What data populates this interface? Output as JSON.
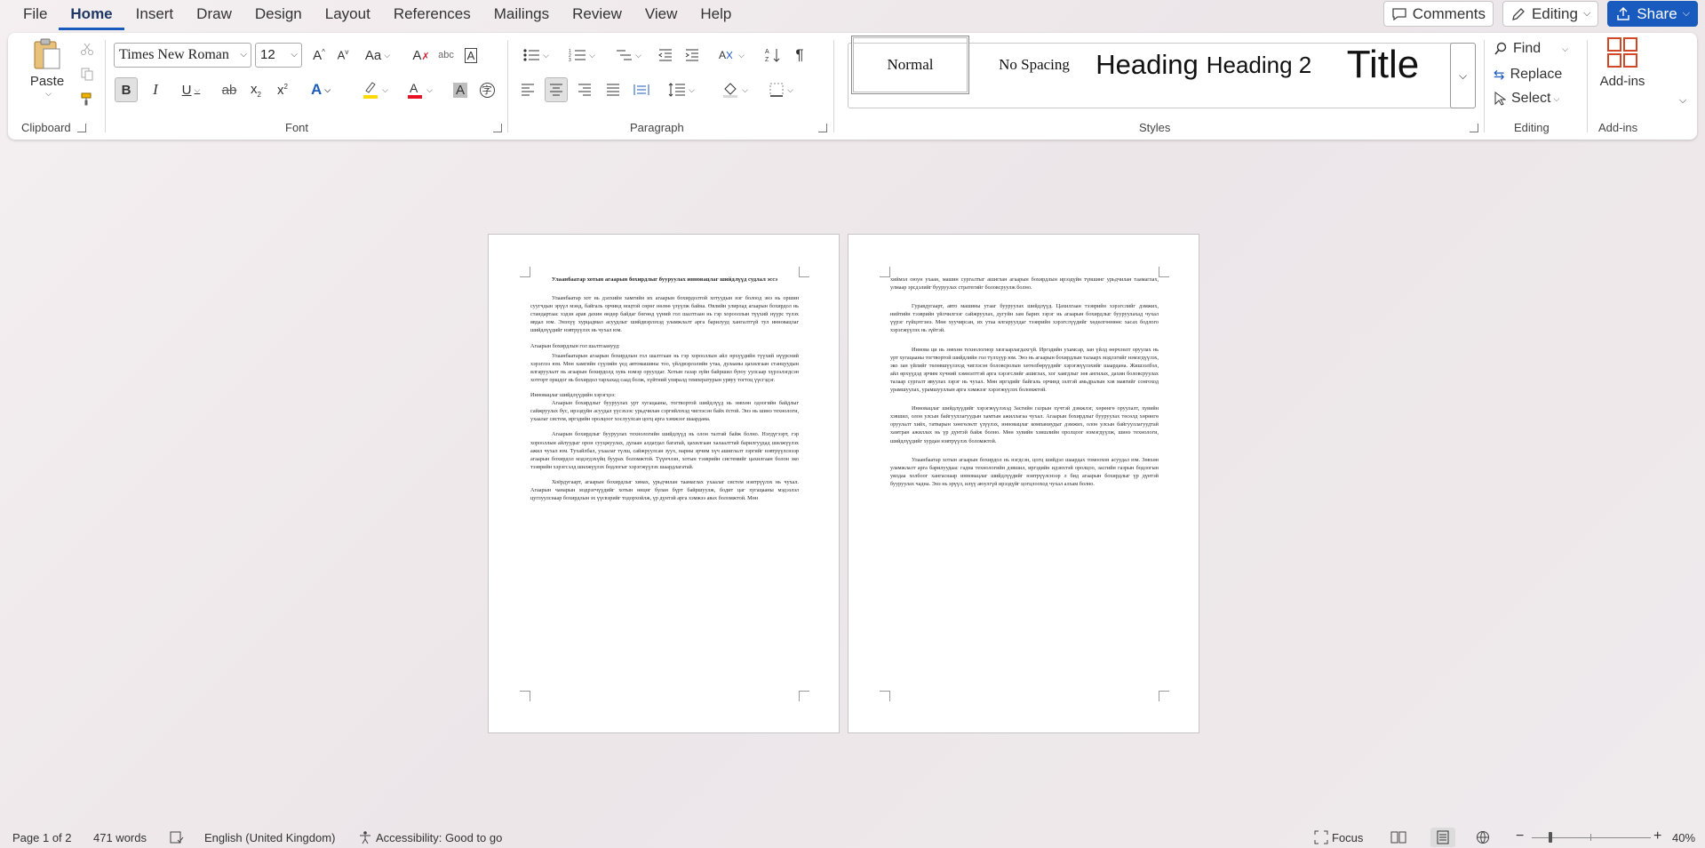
{
  "menu": {
    "tabs": [
      "File",
      "Home",
      "Insert",
      "Draw",
      "Design",
      "Layout",
      "References",
      "Mailings",
      "Review",
      "View",
      "Help"
    ],
    "active": "Home",
    "comments": "Comments",
    "editing": "Editing",
    "share": "Share"
  },
  "ribbon": {
    "clipboard": {
      "paste": "Paste",
      "label": "Clipboard"
    },
    "font": {
      "name": "Times New Roman",
      "size": "12",
      "label": "Font",
      "case_label": "Aa",
      "underline_color": "#ffd800",
      "font_color": "#e81123"
    },
    "paragraph": {
      "label": "Paragraph"
    },
    "styles": {
      "label": "Styles",
      "items": [
        "Normal",
        "No Spacing",
        "Heading",
        "Heading 2",
        "Title"
      ],
      "selected": "Normal"
    },
    "editing": {
      "find": "Find",
      "replace": "Replace",
      "select": "Select",
      "label": "Editing"
    },
    "addins": {
      "button": "Add-ins",
      "label": "Add-ins"
    }
  },
  "document": {
    "page1": {
      "title": "Улаанбаатар хотын агаарын бохирдлыг бууруулах инновацлаг шийдлүүд судлал эссэ",
      "p1": "Улаанбаатар хот нь дэлхийн хамгийн их агаарын бохирдолтой хотуудын нэг болоод энэ нь оршин суугчдын эрүүл мэнд, байгаль орчинд ноцтой сөрөг нөлөө үзүүлж байна. Өвлийн улирлад агаарын бохирдол нь стандартаас хэдэн арав дахин өндөр байдаг бөгөөд үүний гол шалтгаан нь гэр хорооллын түүхий нүүрс түлэх явдал юм. Энэхүү хурцадмал асуудлыг шийдвэрлэхэд уламжлалт арга барилууд хангалтгүй тул инновацлаг шийдлүүдийг нэвтрүүлэх нь чухал юм.",
      "h1": "Агаарын бохирдлын гол шалтгаанууд:",
      "p2": "Улаанбаатарын агаарын бохирдлын гол шалтгаан нь гэр хорооллын айл өрхүүдийн түүхий нүүрсний хэрэглээ юм. Мөн хамгийн сүүлийн үед автомашины тоо, үйлдвэрлэлийн утаа, дулааны цахилгаан станцуудын ялгаруулалт нь агаарын бохирдолд хувь нэмэр оруулдаг. Хотын газар зүйн байршил буюу уулсаар хүрээлэгдсэн хотгорт оршдог нь бохирдол тархахад саад болж, хүйтний улиралд температурын урвуу тогтоц үүсгэдэг.",
      "h2": "Инновацлаг шийдлүүдийн хэрэгцээ:",
      "p3": "Агаарын бохирдлыг бууруулах урт хугацааны, тогтвортой шийдлүүд нь зөвхөн одоогийн байдлыг сайжруулах бус, ирээдүйн асуудал үүсэхээс урьдчилан сэргийлэхэд чиглэсэн байх ёстой. Энэ нь шинэ технологи, ухаалаг систем, иргэдийн оролцоог хослуулсан цогц арга хэмжээг шаардана.",
      "p4": "Агаарын бохирдлыг бууруулах технологийн шийдлүүд нь олон талтай байж болно. Нэгдүгээрт, гэр хорооллын айлуудыг орон сууцжуулах, дулаан алдагдал багатай, цахилгаан халаалттай барилгуудад шилжүүлэх ажил чухал юм. Тухайлбал, ухаалаг түлш, сайжруулсан зуух, нарны эрчим хүч ашиглалт зэргийг нэвтрүүлснээр агаарын бохирдол мэдэгдэхүйц буурах боломжтой. Түүнчлэн, хотын тээврийн системийг цахилгаан болон эко тээврийн хэрэгсэлд шилжүүлэх бодлогыг хэрэгжүүлэх шаардлагатай.",
      "p5": "Хоёрдугаарт, агаарын бохирдлыг хянах, урьдчилан таамаглах ухаалаг систем нэвтрүүлэх нь чухал. Агаарын чанарын мэдрэгчүүдийг хотын өнцөг булан бүрт байршуулж, бодит цаг хугацааны мэдээлэл цуглуулснаар бохирдлын эх үүсвэрийг тодорхойлж, үр дүнтэй арга хэмжээ авах боломжтой. Мөн"
    },
    "page2": {
      "p1": "хиймэл оюун ухаан, машин сургалтыг ашиглан агаарын бохирдлын ирээдүйн түвшинг урьдчилан таамаглах, улмаар эрсдэлийг бууруулах стратегийг боловсруулж болно.",
      "p2": "Гуравдугаарт, авто машины утааг бууруулах шийдлүүд. Цахилгаан тээврийн хэрэгслийг дэмжих, нийтийн тээврийн үйлчилгээг сайжруулах, дугуйн зам барих зэрэг нь агаарын бохирдлыг бууруулахад чухал үүрэг гүйцэтгэнэ. Мөн хуучирсан, их утаа ялгаруулдаг тээврийн хэрэгслүүдийг хөдөлгөөнөөс хасах бодлого хэрэгжүүлэх нь зүйтэй.",
      "p3": "Иннова ци нь зөвхөн технологиор хязгаарлагдахгүй. Иргэдийн ухамсар, зан үйлд өөрчлөлт оруулах нь урт хугацааны тогтвортой шийдлийн гол түлхүүр юм. Энэ нь агаарын бохирдлын талаарх мэдлэгийг нэмэгдүүлэх, эко зан үйлийг төлөвшүүлэхэд чиглэсэн боловсролын хөтөлбөрүүдийг хэрэгжүүлэхийг шаардана. Жишээлбэл, айл өрхүүдэд эрчим хүчний хэмнэлттэй арга хэрэгслийг ашиглах, хог хаягдлыг зөв ангилах, дахин боловсруулах талаар сургалт явуулах зэрэг нь чухал. Мөн иргэдийг байгаль орчинд ээлтэй амьдралын хэв маягийг сонгоход урамшуулах, урамшууллын арга хэмжээг хэрэгжүүлэх боломжтой.",
      "p4": "Инновацлаг шийдлүүдийг хэрэгжүүлэхэд Засгийн газрын хүчтэй дэмжлэг, хөрөнгө оруулалт, хувийн хэвшил, олон улсын байгууллагуудын хамтын ажиллагаа чухал. Агаарын бохирдлыг бууруулах төсөлд хөрөнгө оруулалт хийх, татварын хөнгөлөлт үзүүлэх, инновацлаг компаниудыг дэмжих, олон улсын байгууллагуудтай хамтран ажиллах нь үр дүнтэй байж болно. Мөн хувийн хэвшлийн оролцоог нэмэгдүүлж, шинэ технологи, шийдлүүдийг хурдан нэвтрүүлэх боломжтой.",
      "p5": "Улаанбаатар хотын агаарын бохирдол нь нэгдсэн, цогц шийдэл шаардах томоохон асуудал юм. Зөвхөн уламжлалт арга барилуудаас гадна технологийн дэвшил, иргэдийн идэвхтэй оролцоо, засгийн газрын бодлогын уялдаа холбоог хангаснаар инновацлаг шийдлүүдийг нэвтрүүлснээр л бид агаарын бохирдлыг үр дүнтэй бууруулах чадна. Энэ нь эрүүл, илүү аюулгүй ирээдүйг цогцлооход чухал алхам болно."
    }
  },
  "status": {
    "page": "Page 1 of 2",
    "words": "471 words",
    "language": "English (United Kingdom)",
    "accessibility": "Accessibility: Good to go",
    "focus": "Focus",
    "zoom": "40%"
  }
}
